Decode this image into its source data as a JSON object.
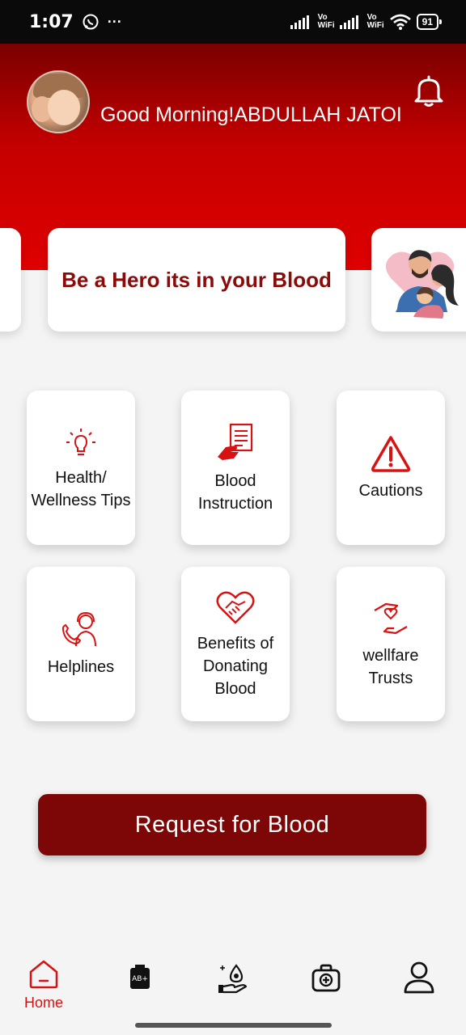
{
  "status_bar": {
    "time": "1:07",
    "vowifi_1_top": "Vo",
    "vowifi_1_bottom": "WiFi",
    "vowifi_2_top": "Vo",
    "vowifi_2_bottom": "WiFi",
    "battery": "91"
  },
  "header": {
    "greeting": "Good Morning!ABDULLAH JATOI",
    "bg_color": "#d00000"
  },
  "carousel": {
    "main_text": "Be a Hero its in your Blood"
  },
  "tiles": [
    {
      "label_line1": "Health/",
      "label_line2": "Wellness Tips",
      "icon": "lightbulb-icon"
    },
    {
      "label_line1": "Blood",
      "label_line2": "Instruction",
      "icon": "document-hand-icon"
    },
    {
      "label_line1": "Cautions",
      "icon": "warning-icon"
    },
    {
      "label_line1": "Helplines",
      "icon": "operator-phone-icon"
    },
    {
      "label_line1": "Benefits of",
      "label_line2": "Donating",
      "label_line3": "Blood",
      "icon": "heart-handshake-icon"
    },
    {
      "label_line1": "wellfare",
      "label_line2": "Trusts",
      "icon": "hands-heart-icon"
    }
  ],
  "request_button": {
    "label": "Request for Blood"
  },
  "bottom_nav": {
    "home_label": "Home",
    "blood_bag_text": "AB+",
    "active_color": "#d81212"
  }
}
